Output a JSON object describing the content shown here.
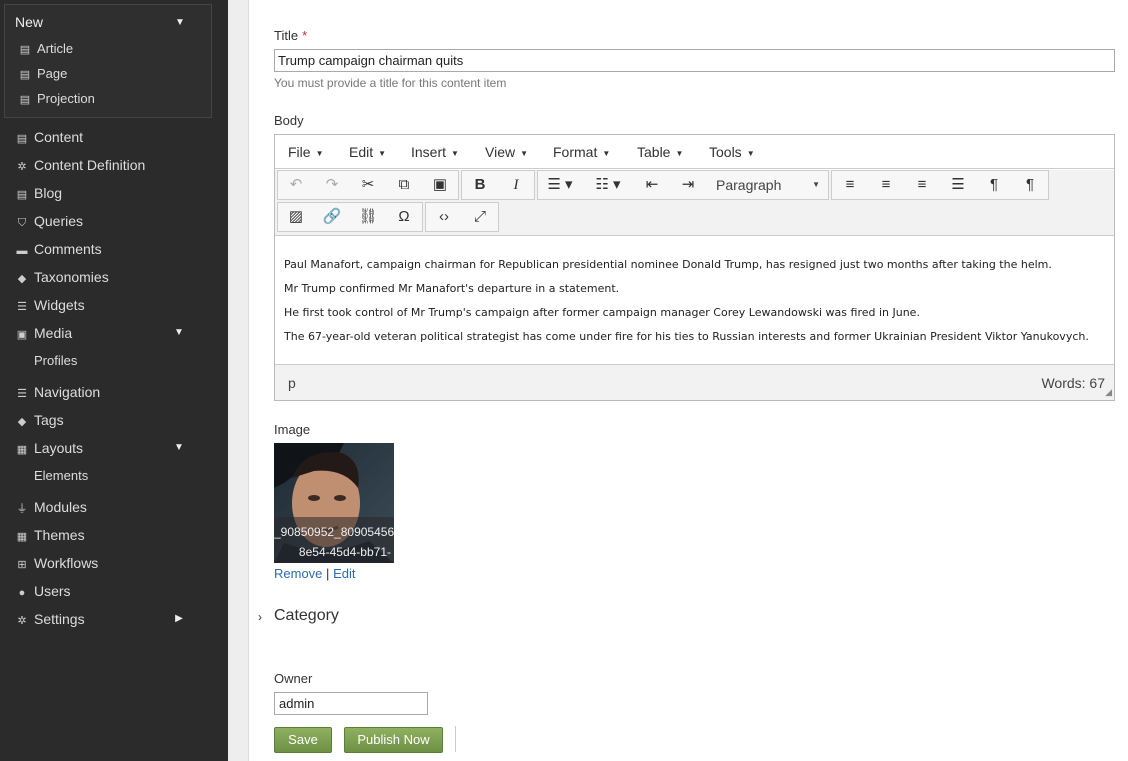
{
  "sidebar": {
    "new": {
      "label": "New",
      "items": [
        {
          "label": "Article",
          "icon": "document-icon"
        },
        {
          "label": "Page",
          "icon": "document-icon"
        },
        {
          "label": "Projection",
          "icon": "document-icon"
        }
      ]
    },
    "items": [
      {
        "label": "Content",
        "icon": "document-icon"
      },
      {
        "label": "Content Definition",
        "icon": "gear-icon"
      },
      {
        "label": "Blog",
        "icon": "document-icon"
      },
      {
        "label": "Queries",
        "icon": "filter-icon"
      },
      {
        "label": "Comments",
        "icon": "comment-icon"
      },
      {
        "label": "Taxonomies",
        "icon": "tag-icon"
      },
      {
        "label": "Widgets",
        "icon": "list-icon"
      },
      {
        "label": "Media",
        "icon": "image-icon"
      },
      {
        "label": "Profiles",
        "icon": ""
      },
      {
        "label": "Navigation",
        "icon": "list-icon"
      },
      {
        "label": "Tags",
        "icon": "tag-icon"
      },
      {
        "label": "Layouts",
        "icon": "layout-icon"
      },
      {
        "label": "Elements",
        "icon": ""
      },
      {
        "label": "Modules",
        "icon": "plug-icon"
      },
      {
        "label": "Themes",
        "icon": "themes-icon"
      },
      {
        "label": "Workflows",
        "icon": "sitemap-icon"
      },
      {
        "label": "Users",
        "icon": "user-icon"
      },
      {
        "label": "Settings",
        "icon": "gear-icon"
      }
    ]
  },
  "form": {
    "title_label": "Title",
    "title_required": "*",
    "title_value": "Trump campaign chairman quits",
    "title_hint": "You must provide a title for this content item",
    "body_label": "Body",
    "image_label": "Image",
    "category_label": "Category",
    "owner_label": "Owner",
    "owner_value": "admin"
  },
  "editor": {
    "menus": [
      "File",
      "Edit",
      "Insert",
      "View",
      "Format",
      "Table",
      "Tools"
    ],
    "format_select": "Paragraph",
    "paragraphs": [
      "Paul Manafort, campaign chairman for Republican presidential nominee Donald Trump, has resigned just two months after taking the helm.",
      "Mr Trump confirmed Mr Manafort's departure in a statement.",
      "He first took control of Mr Trump's campaign after former campaign manager Corey Lewandowski was fired in June.",
      "The 67-year-old veteran political strategist has come under fire for his ties to Russian interests and former Ukrainian President Viktor Yanukovych."
    ],
    "status_path": "p",
    "word_count": "Words: 67"
  },
  "image": {
    "caption_line1": "_90850952_80905456-",
    "caption_line2": "8e54-45d4-bb71-",
    "remove_label": "Remove",
    "separator": "|",
    "edit_label": "Edit"
  },
  "actions": {
    "save_label": "Save",
    "publish_label": "Publish Now"
  },
  "colors": {
    "sidebar_bg": "#2b2b2b",
    "button_green": "#7a9d4f",
    "link_blue": "#2a6db5"
  }
}
